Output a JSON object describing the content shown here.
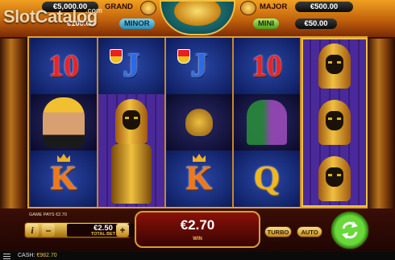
{
  "watermark": {
    "text": "SlotCatalog",
    "suffix": ".com"
  },
  "jackpots": {
    "grand": {
      "label": "GRAND",
      "value": "€5,000.00"
    },
    "major": {
      "label": "MAJOR",
      "value": "€500.00"
    },
    "minor": {
      "label": "MINOR",
      "value": "€100.00"
    },
    "mini": {
      "label": "MINI",
      "value": "€50.00"
    }
  },
  "reels": [
    [
      "10",
      "queen",
      "K"
    ],
    [
      "J",
      "pharaoh",
      "pharaoh"
    ],
    [
      "J",
      "scorpion",
      "K"
    ],
    [
      "10",
      "dancers",
      "Q"
    ],
    [
      "pharaoh-mask",
      "pharaoh-mask",
      "pharaoh-mask"
    ]
  ],
  "panel": {
    "game_pays": "GAME PAYS €2.70",
    "info_label": "i",
    "minus_label": "–",
    "plus_label": "+",
    "total_bet": "€2.50",
    "total_bet_label": "TOTAL BET",
    "win_value": "€2.70",
    "win_label": "WIN",
    "turbo_label": "TURBO",
    "auto_label": "AUTO"
  },
  "footer": {
    "cash_label": "CASH:",
    "cash_value": "€982.70"
  },
  "colors": {
    "spin": "#4ac82a",
    "win_border": "#d8a030",
    "gold": "#f0c040"
  }
}
